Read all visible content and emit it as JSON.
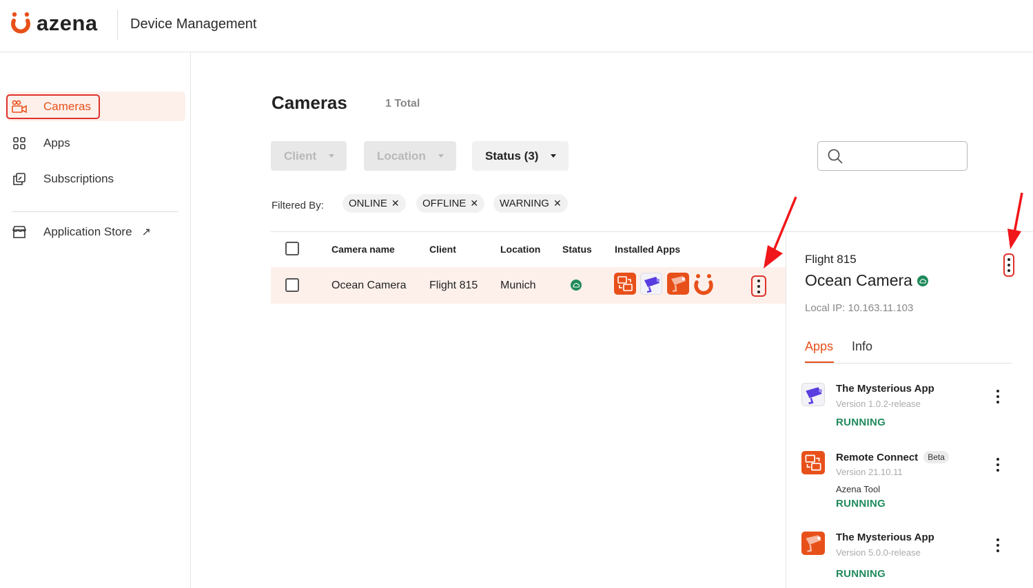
{
  "header": {
    "brand": "azena",
    "title": "Device Management"
  },
  "sidebar": {
    "items": [
      {
        "label": "Cameras",
        "icon": "camera-icon",
        "active": true
      },
      {
        "label": "Apps",
        "icon": "grid-icon"
      },
      {
        "label": "Subscriptions",
        "icon": "subscriptions-icon"
      },
      {
        "label": "Application Store",
        "icon": "store-icon",
        "external": true
      }
    ]
  },
  "main": {
    "title": "Cameras",
    "total": "1 Total",
    "filters": {
      "client": "Client",
      "location": "Location",
      "status": "Status (3)"
    },
    "search": {
      "placeholder": ""
    },
    "filtered_by_label": "Filtered By:",
    "chips": [
      "ONLINE",
      "OFFLINE",
      "WARNING"
    ],
    "table": {
      "headers": [
        "Camera name",
        "Client",
        "Location",
        "Status",
        "Installed Apps"
      ],
      "rows": [
        {
          "camera_name": "Ocean Camera",
          "client": "Flight 815",
          "location": "Munich",
          "status": "online"
        }
      ]
    }
  },
  "details": {
    "client": "Flight 815",
    "camera_name": "Ocean Camera",
    "local_ip": "Local IP: 10.163.11.103",
    "tabs": [
      "Apps",
      "Info"
    ],
    "apps": [
      {
        "name": "The Mysterious App",
        "version": "Version 1.0.2-release",
        "extra": "",
        "status": "RUNNING"
      },
      {
        "name": "Remote Connect",
        "badge": "Beta",
        "version": "Version 21.10.11",
        "extra": "Azena Tool",
        "status": "RUNNING"
      },
      {
        "name": "The Mysterious App",
        "version": "Version 5.0.0-release",
        "extra": "",
        "status": "RUNNING"
      }
    ]
  },
  "colors": {
    "accent": "#e8501a",
    "running": "#1f8a5b",
    "highlight": "#e0302a"
  }
}
